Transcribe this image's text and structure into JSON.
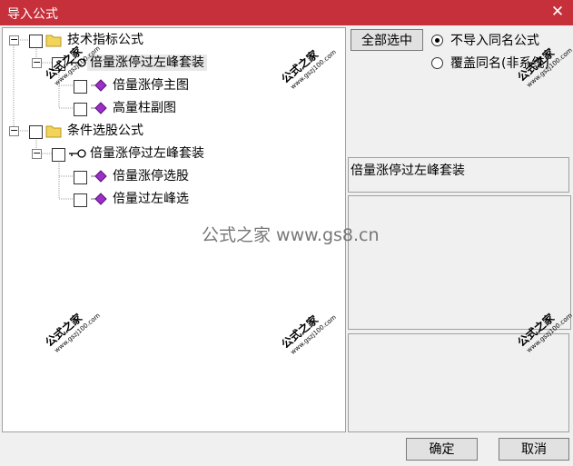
{
  "window": {
    "title": "导入公式",
    "close_glyph": "✕"
  },
  "tree": {
    "groups": [
      {
        "label": "技术指标公式",
        "checked": false,
        "children": [
          {
            "label": "倍量涨停过左峰套装",
            "selected": true,
            "children": [
              {
                "label": "倍量涨停主图"
              },
              {
                "label": "高量柱副图"
              }
            ]
          }
        ]
      },
      {
        "label": "条件选股公式",
        "checked": false,
        "children": [
          {
            "label": "倍量涨停过左峰套装",
            "selected": false,
            "children": [
              {
                "label": "倍量涨停选股"
              },
              {
                "label": "倍量过左峰选"
              }
            ]
          }
        ]
      }
    ]
  },
  "options": {
    "select_all_label": "全部选中",
    "radio_skip_label": "不导入同名公式",
    "radio_overwrite_label": "覆盖同名(非系统)",
    "selected_radio": "skip"
  },
  "detail": {
    "name": "倍量涨停过左峰套装",
    "description": "",
    "info": ""
  },
  "footer": {
    "ok_label": "确定",
    "cancel_label": "取消"
  },
  "watermark": {
    "text": "公式之家",
    "url": "www.gszj100.com",
    "center": "公式之家 www.gs8.cn"
  },
  "colors": {
    "titlebar": "#c6303a",
    "folder": "#f3d45b",
    "formula_icon": "#9b30c9"
  }
}
